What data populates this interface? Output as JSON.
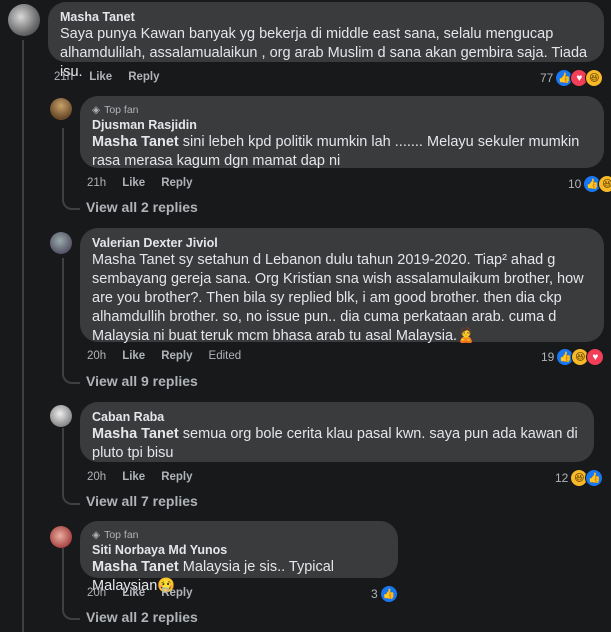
{
  "comments": [
    {
      "author": "Masha Tanet",
      "badge": "",
      "mention": "",
      "text": "Saya punya Kawan banyak yg bekerja di middle east sana, selalu mengucap alhamdulilah, assalamualaikun , org arab Muslim d sana akan gembira saja. Tiada isu.",
      "time": "21h",
      "like": "Like",
      "reply": "Reply",
      "edited": "",
      "react_count": "77",
      "view_replies": ""
    },
    {
      "author": "Djusman Rasjidin",
      "badge": "Top fan",
      "mention": "Masha Tanet",
      "text": "sini lebeh kpd politik mumkin lah ....... Melayu sekuler mumkin rasa merasa kagum dgn mamat dap ni",
      "time": "21h",
      "like": "Like",
      "reply": "Reply",
      "edited": "",
      "react_count": "10",
      "view_replies": "View all 2 replies"
    },
    {
      "author": "Valerian Dexter Jiviol",
      "badge": "",
      "mention": "",
      "text": "Masha Tanet sy setahun d Lebanon dulu tahun 2019-2020. Tiap² ahad g sembayang gereja sana. Org Kristian sna wish assalamulaikum brother, how are you brother?. Then bila sy replied blk, i am good brother. then dia ckp alhamdullih brother. so, no issue pun.. dia cuma perkataan arab. cuma d Malaysia ni buat teruk mcm bhasa arab tu asal Malaysia.🙎",
      "time": "20h",
      "like": "Like",
      "reply": "Reply",
      "edited": "Edited",
      "react_count": "19",
      "view_replies": "View all 9 replies"
    },
    {
      "author": "Caban Raba",
      "badge": "",
      "mention": "Masha Tanet",
      "text": "semua org bole cerita klau pasal kwn. saya pun ada kawan di pluto tpi bisu",
      "time": "20h",
      "like": "Like",
      "reply": "Reply",
      "edited": "",
      "react_count": "12",
      "view_replies": "View all 7 replies"
    },
    {
      "author": "Siti Norbaya Md Yunos",
      "badge": "Top fan",
      "mention": "Masha Tanet",
      "text": "Malaysia je sis.. Typical Malaysian🥴",
      "time": "20h",
      "like": "Like",
      "reply": "Reply",
      "edited": "",
      "react_count": "3",
      "view_replies": "View all 2 replies"
    }
  ],
  "icons": {
    "like": "thumbs-up-icon",
    "love": "heart-icon",
    "haha": "laugh-face-icon",
    "badge": "diamond-icon"
  },
  "colors": {
    "background": "#18191a",
    "bubble": "#3a3b3c",
    "like": "#1877f2",
    "love": "#f33e58",
    "haha": "#f7b928"
  }
}
